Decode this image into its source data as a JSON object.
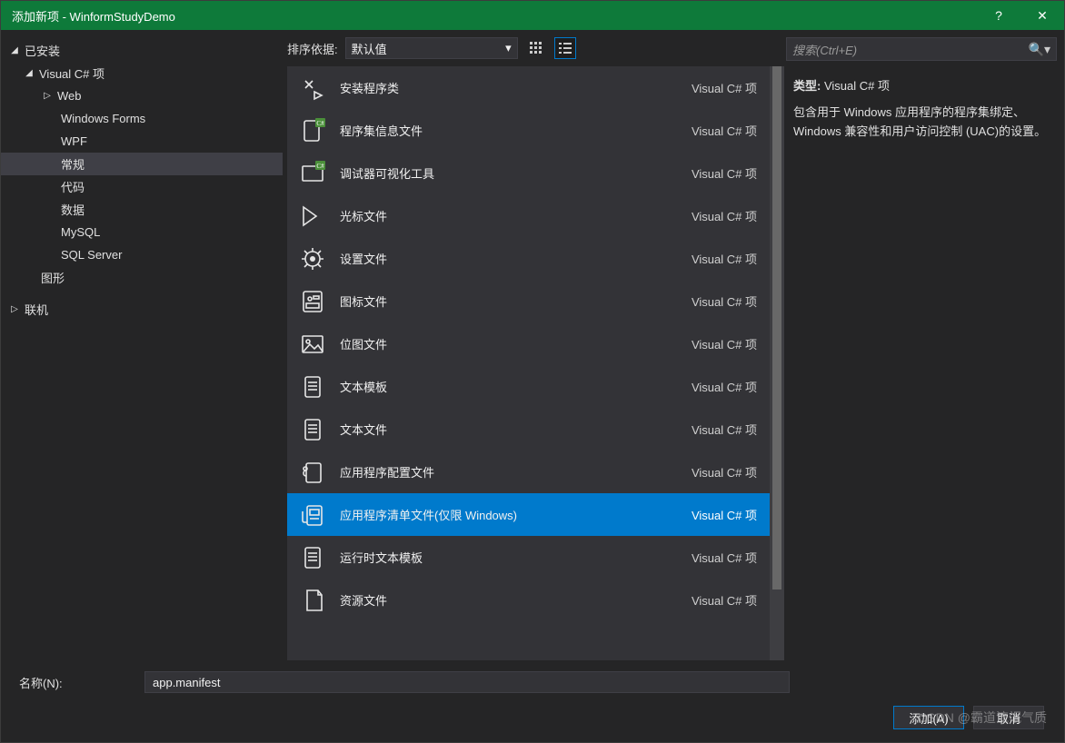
{
  "window": {
    "title": "添加新项 - WinformStudyDemo",
    "help": "?",
    "close": "✕"
  },
  "sidebar": {
    "installed": "已安装",
    "visualcs": "Visual C# 项",
    "web": "Web",
    "winforms": "Windows Forms",
    "wpf": "WPF",
    "general": "常规",
    "code": "代码",
    "data": "数据",
    "mysql": "MySQL",
    "sqlserver": "SQL Server",
    "graphics": "图形",
    "online": "联机"
  },
  "toolbar": {
    "sort_label": "排序依据:",
    "sort_value": "默认值"
  },
  "search": {
    "placeholder": "搜索(Ctrl+E)"
  },
  "category": "Visual C# 项",
  "items": [
    {
      "label": "安装程序类"
    },
    {
      "label": "程序集信息文件"
    },
    {
      "label": "调试器可视化工具"
    },
    {
      "label": "光标文件"
    },
    {
      "label": "设置文件"
    },
    {
      "label": "图标文件"
    },
    {
      "label": "位图文件"
    },
    {
      "label": "文本模板"
    },
    {
      "label": "文本文件"
    },
    {
      "label": "应用程序配置文件"
    },
    {
      "label": "应用程序清单文件(仅限 Windows)",
      "selected": true
    },
    {
      "label": "运行时文本模板"
    },
    {
      "label": "资源文件"
    }
  ],
  "details": {
    "type_label": "类型:",
    "type_value": "Visual C# 项",
    "description": "包含用于 Windows 应用程序的程序集绑定、Windows 兼容性和用户访问控制 (UAC)的设置。"
  },
  "footer": {
    "name_label": "名称(N):",
    "name_value": "app.manifest",
    "add": "添加(A)",
    "cancel": "取消"
  },
  "watermark": "CSDN @霸道流氓气质"
}
